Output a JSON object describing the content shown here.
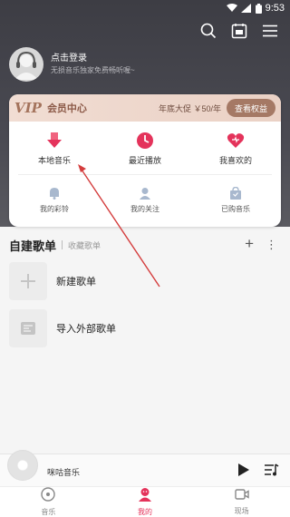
{
  "status_bar": {
    "time": "9:53"
  },
  "profile": {
    "login": "点击登录",
    "subtitle": "无损音乐独家免费畅听喔~"
  },
  "vip": {
    "logo": "VIP",
    "title": "会员中心",
    "promo": "年底大促 ￥50/年",
    "button": "查看权益"
  },
  "grid_row1": [
    {
      "label": "本地音乐",
      "icon": "download-icon"
    },
    {
      "label": "最近播放",
      "icon": "clock-icon"
    },
    {
      "label": "我喜欢的",
      "icon": "heart-icon"
    }
  ],
  "grid_row2": [
    {
      "label": "我的彩铃",
      "icon": "bell-icon"
    },
    {
      "label": "我的关注",
      "icon": "person-icon"
    },
    {
      "label": "已购音乐",
      "icon": "bag-icon"
    }
  ],
  "playlists": {
    "title": "自建歌单",
    "tab": "收藏歌单",
    "items": [
      {
        "label": "新建歌单"
      },
      {
        "label": "导入外部歌单"
      }
    ]
  },
  "mini_player": {
    "title": "咪咕音乐"
  },
  "bottom_nav": [
    {
      "label": "音乐"
    },
    {
      "label": "我的"
    },
    {
      "label": "现场"
    }
  ],
  "colors": {
    "accent": "#e4335b",
    "vip_brown": "#a57965"
  }
}
